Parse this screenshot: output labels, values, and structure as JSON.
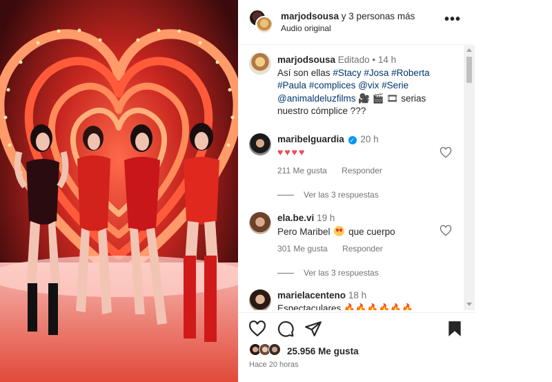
{
  "header": {
    "username": "marjodsousa",
    "others": "y 3 personas más",
    "audio": "Audio original",
    "more_icon": "more-dots-icon"
  },
  "caption": {
    "username": "marjodsousa",
    "edited": "Editado",
    "sep": "•",
    "time": "14 h",
    "text_start": "Así son ellas",
    "tags": [
      "#Stacy",
      "#Josa",
      "#Roberta",
      "#Paula",
      "#complices",
      "@vix",
      "#Serie",
      "@animaldeluzfilms"
    ],
    "emojis": "🎥 🎬 🎞",
    "text_end": "serias nuestro cómplice ???"
  },
  "comments": [
    {
      "username": "maribelguardia",
      "verified": true,
      "time": "20 h",
      "text": "♥♥♥♥",
      "likes": "211 Me gusta",
      "reply": "Responder",
      "view_replies": "Ver las 3 respuestas"
    },
    {
      "username": "ela.be.vi",
      "verified": false,
      "time": "19 h",
      "text_before": "Pero Maribel",
      "text_after": "que cuerpo",
      "likes": "301 Me gusta",
      "reply": "Responder",
      "view_replies": "Ver las 3 respuestas"
    },
    {
      "username": "marielacenteno",
      "verified": false,
      "time": "18 h",
      "text": "Espectaculares",
      "flames": "🔥🔥🔥🔥🔥🔥"
    }
  ],
  "actions": {
    "like_icon": "heart-icon",
    "comment_icon": "comment-icon",
    "share_icon": "share-icon",
    "save_icon": "bookmark-icon"
  },
  "likes": {
    "count": "25.956",
    "label": "Me gusta"
  },
  "date": "Hace 20 horas",
  "colors": {
    "link": "#00376b",
    "verified": "#0095f6",
    "heart": "#ed4956",
    "muted": "#737373"
  }
}
